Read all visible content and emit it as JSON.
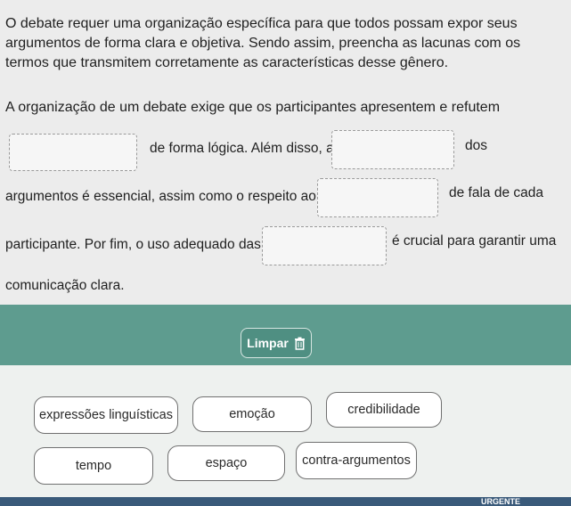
{
  "instructions": "O debate requer uma organização específica para que todos possam expor seus argumentos de forma clara e objetiva. Sendo assim, preencha as lacunas com os termos que transmitem corretamente as características desse gênero.",
  "sentence": {
    "intro": "A organização de um debate exige que os participantes apresentem e refutem",
    "part1": "de forma lógica. Além disso, a",
    "part2": "dos",
    "part3": "argumentos é essencial, assim como o respeito ao",
    "part4": "de fala de cada",
    "part5": "participante. Por fim, o uso adequado das",
    "part6": "é crucial para garantir uma",
    "part7": "comunicação clara."
  },
  "clear_button": {
    "label": "Limpar",
    "icon": "trash-icon"
  },
  "word_bank": [
    "expressões linguísticas",
    "emoção",
    "credibilidade",
    "tempo",
    "espaço",
    "contra-argumentos"
  ],
  "taskbar": {
    "label": "URGENTE"
  },
  "colors": {
    "green_bar": "#5e9c8f",
    "button": "#4f8f82"
  }
}
